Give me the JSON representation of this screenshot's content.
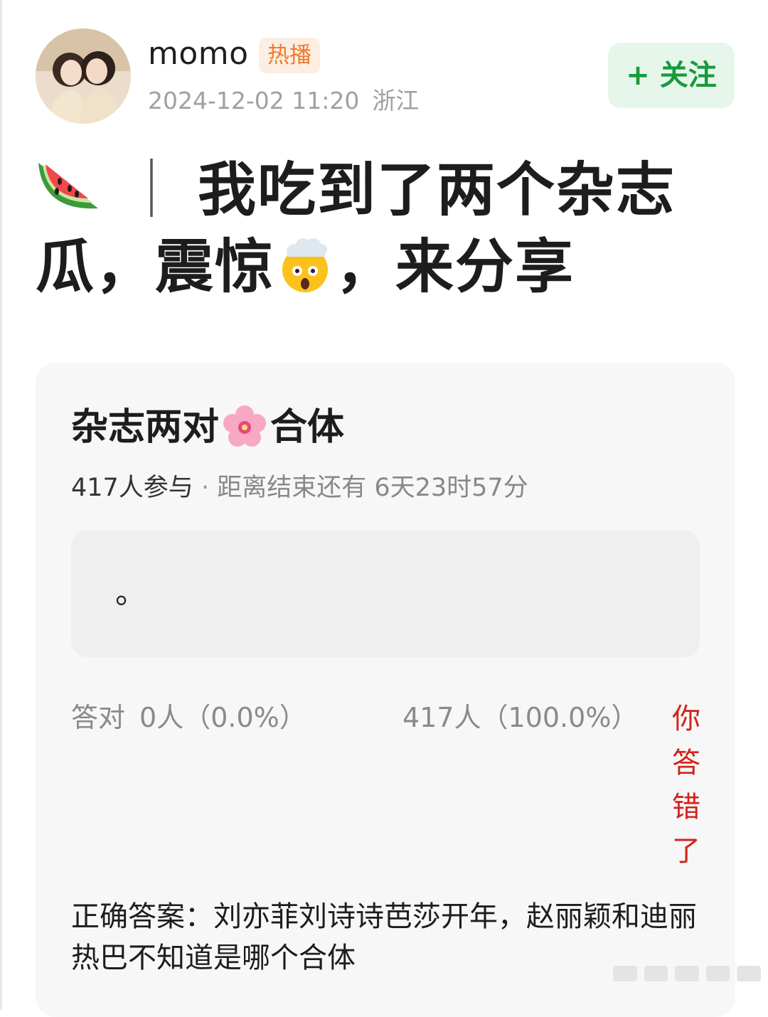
{
  "post": {
    "author": {
      "name": "momo",
      "badge": "热播",
      "timestamp": "2024-12-02 11:20",
      "location": "浙江"
    },
    "follow_label": "+ 关注",
    "title": {
      "part1": "我吃到了两个杂志",
      "part2": "瓜，震惊",
      "part3": "，来分享",
      "separator": "｜"
    }
  },
  "quiz": {
    "title_a": "杂志两对",
    "title_b": "合体",
    "participants": "417人参与",
    "separator": "·",
    "countdown": "距离结束还有 6天23时57分",
    "option_text": "。",
    "correct_label": "答对",
    "correct_count": "0人（0.0%）",
    "wrong_count": "417人（100.0%）",
    "result_tag": "你答错了",
    "answer": "正确答案：刘亦菲刘诗诗芭莎开年，赵丽颖和迪丽热巴不知道是哪个合体"
  },
  "colors": {
    "follow_green": "#179a3e",
    "badge_orange": "#f07a2e",
    "wrong_red": "#d2231b"
  },
  "icons": [
    "avatar-photo",
    "watermelon-emoji",
    "mind-blown-emoji",
    "cherry-blossom-emoji"
  ]
}
